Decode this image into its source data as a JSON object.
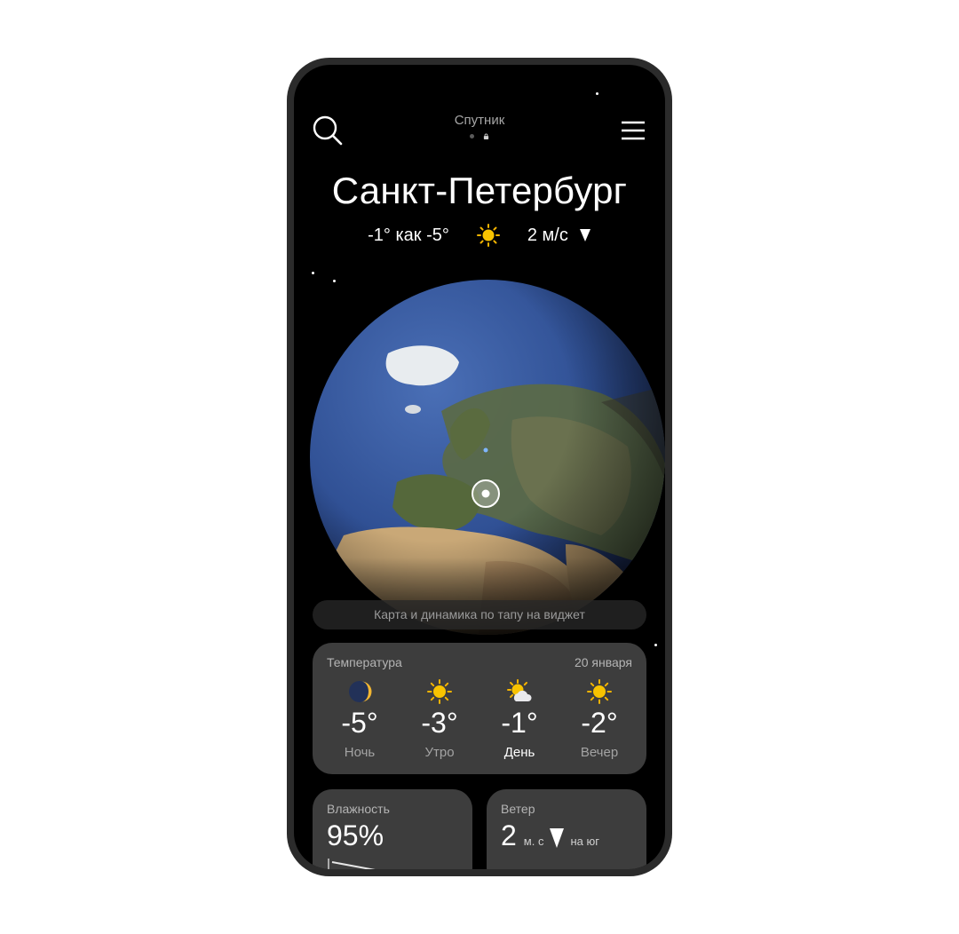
{
  "header": {
    "mode_label": "Спутник",
    "search_icon": "search-icon",
    "menu_icon": "hamburger-menu-icon"
  },
  "city": "Санкт-Петербург",
  "current": {
    "temp_feels": "-1° как -5°",
    "condition_icon": "sun-icon",
    "wind": "2 м/с",
    "wind_icon": "wind-direction-arrow-icon"
  },
  "globe": {
    "hint": "Карта и динамика по тапу на виджет"
  },
  "temperature_card": {
    "title": "Температура",
    "date": "20 января",
    "periods": [
      {
        "temp": "-5°",
        "name": "Ночь",
        "icon": "moon-icon"
      },
      {
        "temp": "-3°",
        "name": "Утро",
        "icon": "sun-icon"
      },
      {
        "temp": "-1°",
        "name": "День",
        "icon": "sun-cloud-icon",
        "active": true
      },
      {
        "temp": "-2°",
        "name": "Вечер",
        "icon": "sun-icon"
      }
    ]
  },
  "humidity_card": {
    "title": "Влажность",
    "value": "95%"
  },
  "wind_card": {
    "title": "Ветер",
    "value": "2",
    "unit": "м. с",
    "direction": "на юг"
  },
  "colors": {
    "background": "#000000",
    "card": "#3d3d3d",
    "sun": "#f5b400",
    "text_primary": "#ffffff",
    "text_secondary": "#a3a3a3"
  }
}
